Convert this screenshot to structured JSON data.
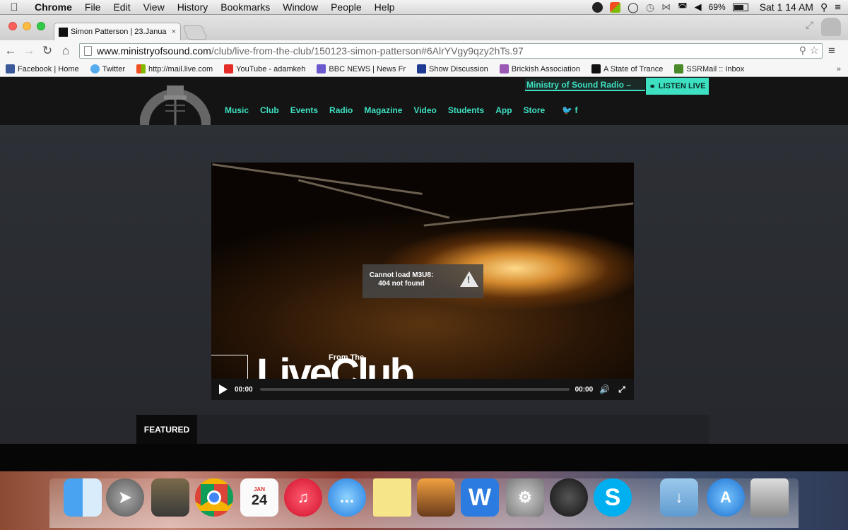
{
  "menubar": {
    "app": "Chrome",
    "menus": [
      "File",
      "Edit",
      "View",
      "History",
      "Bookmarks",
      "Window",
      "People",
      "Help"
    ],
    "battery": "69%",
    "clock": "Sat 1 14 AM"
  },
  "tab": {
    "title": "Simon Patterson | 23.Janua",
    "close": "×"
  },
  "omnibox": {
    "host": "www.ministryofsound.com",
    "path": "/club/live-from-the-club/150123-simon-patterson#6AlrYVgy9qzy2hTs.97"
  },
  "bookmarks": [
    {
      "label": "Facebook | Home",
      "color": "#3b5998"
    },
    {
      "label": "Twitter",
      "color": "#55acee"
    },
    {
      "label": "http://mail.live.com",
      "color": "#f25022"
    },
    {
      "label": "YouTube - adamkeh",
      "color": "#e52d27"
    },
    {
      "label": "BBC NEWS | News Fr",
      "color": "#6a5acd"
    },
    {
      "label": "Show Discussion",
      "color": "#1f3a93"
    },
    {
      "label": "Brickish Association",
      "color": "#9b59b6"
    },
    {
      "label": "A State of Trance",
      "color": "#111111"
    },
    {
      "label": "SSRMail :: Inbox",
      "color": "#4a8a2a"
    }
  ],
  "site": {
    "nav": [
      "Music",
      "Club",
      "Events",
      "Radio",
      "Magazine",
      "Video",
      "Students",
      "App",
      "Store"
    ],
    "social": "🐦 f",
    "radio_label": "Ministry of Sound Radio –",
    "listen_label": "LISTEN LIVE",
    "accent": "#3de0c1"
  },
  "player": {
    "error_line1": "Cannot load M3U8:",
    "error_line2": "404 not found",
    "from_the": "From The",
    "live_club": "LiveClub",
    "time_start": "00:00",
    "time_end": "00:00"
  },
  "featured": {
    "label": "FEATURED"
  },
  "dock": {
    "calendar_month": "JAN",
    "calendar_day": "24",
    "icons": [
      "finder-icon",
      "launchpad-icon",
      "mission-control-icon",
      "chrome-icon",
      "calendar-icon",
      "itunes-icon",
      "messages-icon",
      "stickies-icon",
      "iphoto-icon",
      "word-icon",
      "system-preferences-icon",
      "djay-icon",
      "skype-icon",
      "downloads-folder-icon",
      "app-store-icon",
      "trash-icon"
    ]
  }
}
